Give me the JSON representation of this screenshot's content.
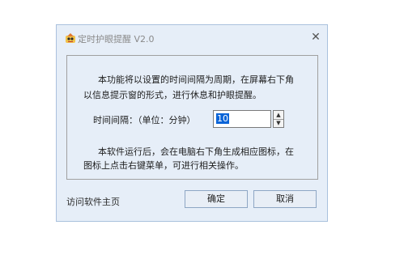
{
  "window": {
    "title": "定时护眼提醒 V2.0",
    "close_glyph": "✕",
    "icon": "eye-reminder-app-icon"
  },
  "description": {
    "line1": "本功能将以设置的时间间隔为周期，在屏幕右下角",
    "line2": "以信息提示窗的形式，进行休息和护眼提醒。"
  },
  "interval": {
    "label": "时间间隔：（单位：分钟）",
    "value": "10",
    "spin_up": "▲",
    "spin_down": "▼"
  },
  "note": {
    "line1": "本软件运行后，会在电脑右下角生成相应图标，在",
    "line2": "图标上点击右键菜单，可进行相关操作。"
  },
  "footer": {
    "homepage_link": "访问软件主页",
    "ok_label": "确定",
    "cancel_label": "取消"
  },
  "colors": {
    "dialog_bg": "#e6eef8",
    "border": "#aac1dd",
    "selection": "#0a64d8"
  }
}
